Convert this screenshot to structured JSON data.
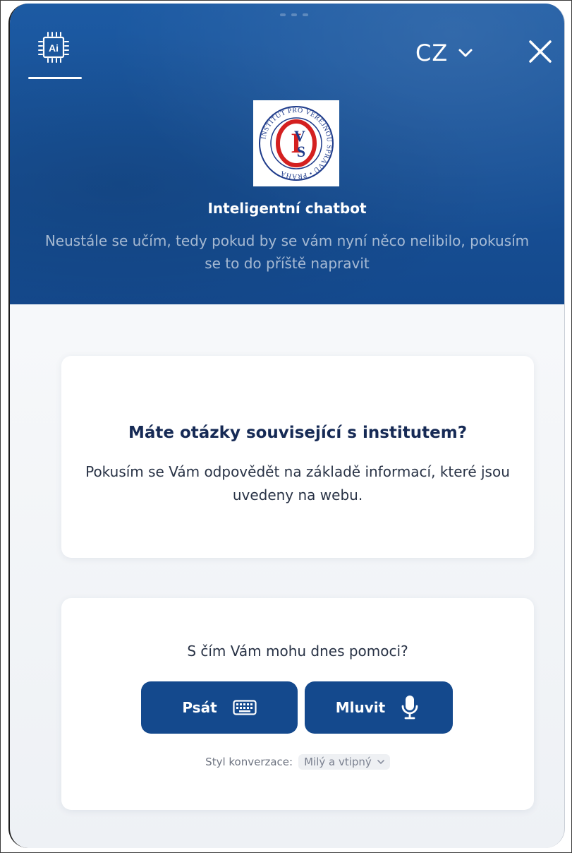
{
  "header": {
    "ai_icon": "ai-chip-icon",
    "language": "CZ",
    "close_icon": "close-icon",
    "logo_name": "IVS institute logo",
    "logo_text": "INSTITUT PRO VEŘEJNOU SPRÁVU • PRAHA",
    "title": "Inteligentní chatbot",
    "subtitle": "Neustále se učím, tedy pokud by se vám nyní něco nelibilo, pokusím se to do příště napravit"
  },
  "info_card": {
    "question": "Máte otázky související s institutem?",
    "answer": "Pokusím se Vám odpovědět na základě informací, které jsou uvedeny na webu."
  },
  "help_card": {
    "prompt": "S čím Vám mohu dnes pomoci?",
    "write_label": "Psát",
    "write_icon": "keyboard-icon",
    "speak_label": "Mluvit",
    "speak_icon": "microphone-icon",
    "style_label": "Styl konverzace:",
    "style_value": "Milý a vtipný"
  },
  "colors": {
    "brand_blue": "#14498d",
    "header_blue": "#1c5aa3",
    "title_dark": "#162a55"
  }
}
